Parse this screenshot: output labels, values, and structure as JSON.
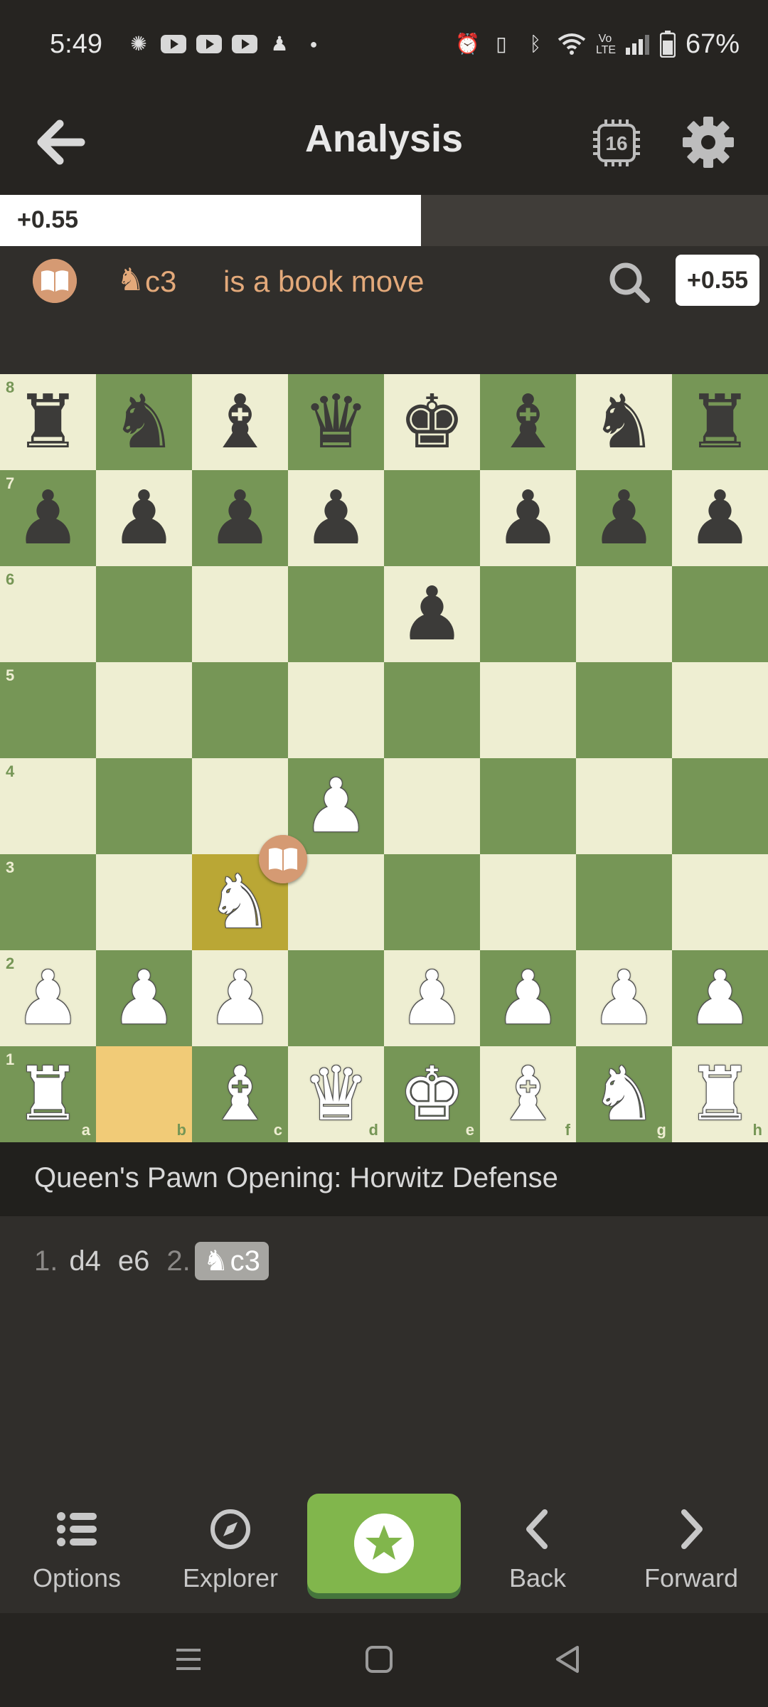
{
  "status_bar": {
    "time": "5:49",
    "battery": "67%",
    "left_icons": [
      "brightness-icon",
      "youtube-icon",
      "youtube-icon",
      "youtube-icon",
      "chess-pawn-icon",
      "dot-icon"
    ],
    "right_icons": [
      "alarm-icon",
      "vibrate-icon",
      "bluetooth-icon",
      "wifi-icon",
      "volte-icon",
      "signal-icon",
      "battery-icon"
    ]
  },
  "header": {
    "title": "Analysis",
    "engine_depth": "16"
  },
  "eval_bar": {
    "label": "+0.55",
    "white_fraction": 0.548
  },
  "move_comment": {
    "piece_glyph": "♞",
    "move": "c3",
    "text": "is a book move",
    "score": "+0.55"
  },
  "board": {
    "colors": {
      "light": "#eeeed2",
      "dark": "#769656",
      "last_move_to": "#baa735",
      "last_move_from": "#f1cb77"
    },
    "ranks": [
      "8",
      "7",
      "6",
      "5",
      "4",
      "3",
      "2",
      "1"
    ],
    "files": [
      "a",
      "b",
      "c",
      "d",
      "e",
      "f",
      "g",
      "h"
    ],
    "last_move": {
      "from": "b1",
      "to": "c3"
    },
    "pieces": [
      {
        "sq": "a8",
        "p": "r",
        "c": "b"
      },
      {
        "sq": "b8",
        "p": "n",
        "c": "b"
      },
      {
        "sq": "c8",
        "p": "b",
        "c": "b"
      },
      {
        "sq": "d8",
        "p": "q",
        "c": "b"
      },
      {
        "sq": "e8",
        "p": "k",
        "c": "b"
      },
      {
        "sq": "f8",
        "p": "b",
        "c": "b"
      },
      {
        "sq": "g8",
        "p": "n",
        "c": "b"
      },
      {
        "sq": "h8",
        "p": "r",
        "c": "b"
      },
      {
        "sq": "a7",
        "p": "p",
        "c": "b"
      },
      {
        "sq": "b7",
        "p": "p",
        "c": "b"
      },
      {
        "sq": "c7",
        "p": "p",
        "c": "b"
      },
      {
        "sq": "d7",
        "p": "p",
        "c": "b"
      },
      {
        "sq": "f7",
        "p": "p",
        "c": "b"
      },
      {
        "sq": "g7",
        "p": "p",
        "c": "b"
      },
      {
        "sq": "h7",
        "p": "p",
        "c": "b"
      },
      {
        "sq": "e6",
        "p": "p",
        "c": "b"
      },
      {
        "sq": "d4",
        "p": "p",
        "c": "w"
      },
      {
        "sq": "c3",
        "p": "n",
        "c": "w"
      },
      {
        "sq": "a2",
        "p": "p",
        "c": "w"
      },
      {
        "sq": "b2",
        "p": "p",
        "c": "w"
      },
      {
        "sq": "c2",
        "p": "p",
        "c": "w"
      },
      {
        "sq": "e2",
        "p": "p",
        "c": "w"
      },
      {
        "sq": "f2",
        "p": "p",
        "c": "w"
      },
      {
        "sq": "g2",
        "p": "p",
        "c": "w"
      },
      {
        "sq": "h2",
        "p": "p",
        "c": "w"
      },
      {
        "sq": "a1",
        "p": "r",
        "c": "w"
      },
      {
        "sq": "c1",
        "p": "b",
        "c": "w"
      },
      {
        "sq": "d1",
        "p": "q",
        "c": "w"
      },
      {
        "sq": "e1",
        "p": "k",
        "c": "w"
      },
      {
        "sq": "f1",
        "p": "b",
        "c": "w"
      },
      {
        "sq": "g1",
        "p": "n",
        "c": "w"
      },
      {
        "sq": "h1",
        "p": "r",
        "c": "w"
      }
    ]
  },
  "opening": {
    "name": "Queen's Pawn Opening: Horwitz Defense"
  },
  "moves": {
    "m1_num": "1.",
    "m1_white": "d4",
    "m1_black": "e6",
    "m2_num": "2.",
    "m2_piece": "♞",
    "m2_white": "c3"
  },
  "bottom_nav": {
    "options": "Options",
    "explorer": "Explorer",
    "back": "Back",
    "forward": "Forward"
  },
  "accent": {
    "green": "#81b64c",
    "book": "#d59a73"
  }
}
